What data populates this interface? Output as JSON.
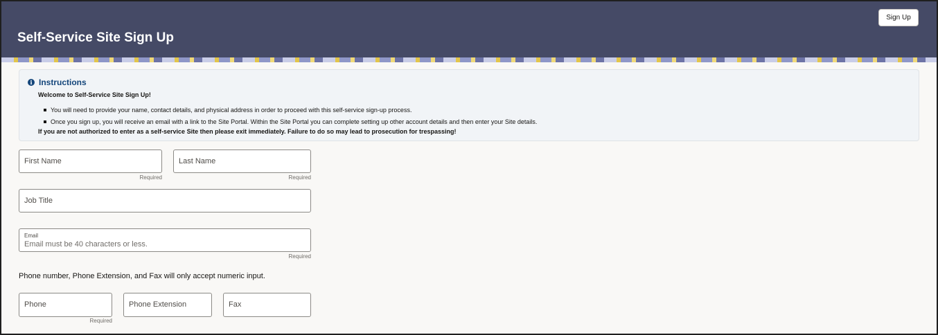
{
  "header": {
    "title": "Self-Service Site Sign Up",
    "signup_button": "Sign Up",
    "background_color": "#454a66"
  },
  "instructions": {
    "icon": "info-icon",
    "title": "Instructions",
    "welcome": "Welcome to Self-Service Site Sign Up!",
    "bullets": [
      "You will need to provide your name, contact details, and physical address in order to proceed with this self-service sign-up process.",
      "Once you sign up, you will receive an email with a link to the Site Portal. Within the Site Portal you can complete setting up other account details and then enter your Site details."
    ],
    "warning": "If you are not authorized to enter as a self-service Site then please exit immediately. Failure to do so may lead to prosecution for trespassing!"
  },
  "form": {
    "first_name": {
      "placeholder": "First Name",
      "helper": "Required"
    },
    "last_name": {
      "placeholder": "Last Name",
      "helper": "Required"
    },
    "job_title": {
      "placeholder": "Job Title"
    },
    "email": {
      "label": "Email",
      "placeholder": "Email must be 40 characters or less.",
      "helper": "Required"
    },
    "numeric_note": "Phone number, Phone Extension, and Fax will only accept numeric input.",
    "phone": {
      "placeholder": "Phone",
      "helper": "Required"
    },
    "phone_extension": {
      "placeholder": "Phone Extension"
    },
    "fax": {
      "placeholder": "Fax"
    }
  }
}
